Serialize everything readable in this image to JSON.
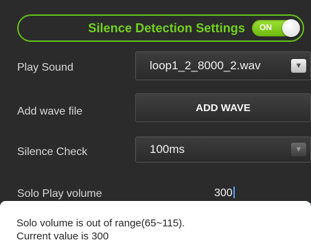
{
  "header": {
    "title": "Silence Detection Settings",
    "toggle_label": "ON"
  },
  "play_sound": {
    "label": "Play Sound",
    "selected": "loop1_2_8000_2.wav",
    "arrow": "▼"
  },
  "add_wave": {
    "label": "Add wave file",
    "button_label": "ADD WAVE"
  },
  "silence_check": {
    "label": "Silence Check",
    "selected": "100ms",
    "arrow": "▼"
  },
  "solo_volume": {
    "label": "Solo Play volume",
    "value": "300"
  },
  "toast": {
    "line1": "Solo volume is out of range(65~115).",
    "line2": "Current value is 300"
  },
  "colors": {
    "accent": "#66c21a",
    "background": "#2b2b2b"
  }
}
